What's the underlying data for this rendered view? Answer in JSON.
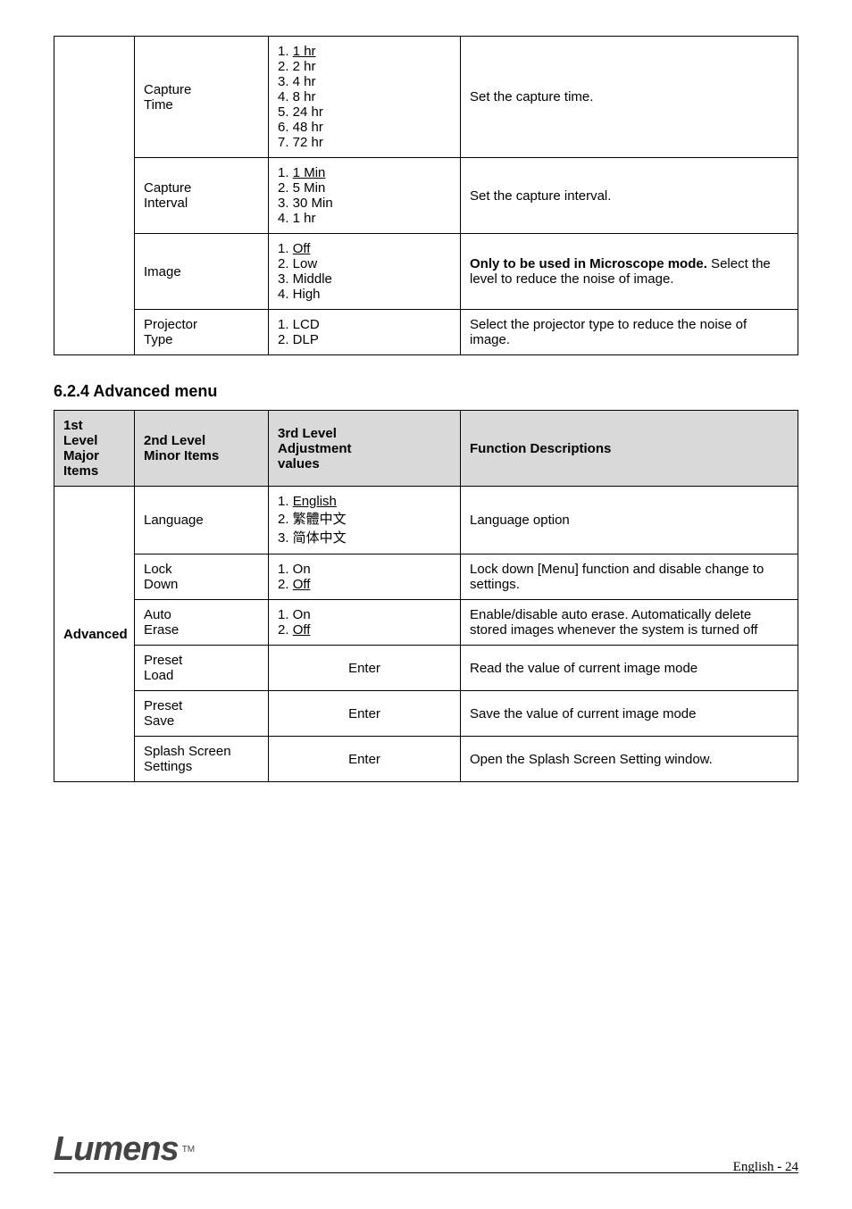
{
  "table1": {
    "col1_rowspan_label": "",
    "rows": [
      {
        "c2_line1": "Capture",
        "c2_line2": "Time",
        "c3_line1_prefix": "1.",
        "c3_line1_u": "1 hr",
        "c3_line2": "2. 2 hr",
        "c3_line3": "3. 4 hr",
        "c3_line4": "4. 8 hr",
        "c3_line5": "5. 24 hr",
        "c3_line6": "6. 48 hr",
        "c3_line7": "7. 72 hr",
        "c4": "Set the capture time."
      },
      {
        "c2_line1": "Capture",
        "c2_line2": "Interval",
        "c3_line1_prefix": "1.",
        "c3_line1_u": "1 Min",
        "c3_line2": "2. 5 Min",
        "c3_line3": "3. 30 Min",
        "c3_line4": "4. 1 hr",
        "c4": "Set the capture interval."
      },
      {
        "c2": "Image",
        "c3_line1_prefix": "1.",
        "c3_line1_u": "Off",
        "c3_line2": "2. Low",
        "c3_line3": "3. Middle",
        "c3_line4": "4. High",
        "c4_b": "Only to be used in Microscope mode.",
        "c4_rest": " Select the level to reduce the noise of image."
      },
      {
        "c2_line1": "Projector",
        "c2_line2": "Type",
        "c3_line1": "1. LCD",
        "c3_line2": "2. DLP",
        "c4": "Select the projector type to reduce the noise of image."
      }
    ]
  },
  "section_title": "6.2.4 Advanced menu",
  "table2": {
    "headers": {
      "h1_line1": "1st",
      "h1_line2": "Level",
      "h1_line3": "Major",
      "h1_line4": "Items",
      "h2_line1": "2nd Level",
      "h2_line2": "Minor Items",
      "h3_line1": "3rd Level",
      "h3_line2": "Adjustment",
      "h3_line3": "values",
      "h4": "Function Descriptions"
    },
    "group_label": "Advanced",
    "rows": [
      {
        "c2": "Language",
        "c3_prefix": "1.",
        "c3_u": "English",
        "c3_line2": "2. 繁體中文",
        "c3_line3": "3. 简体中文",
        "c4": "Language option"
      },
      {
        "c2_line1": "Lock",
        "c2_line2": "Down",
        "c3_line1_prefix": "1. On",
        "c3_line2_prefix": "2.",
        "c3_line2_u": "Off",
        "c4": "Lock down [Menu] function and disable change to settings."
      },
      {
        "c2_line1": "Auto",
        "c2_line2": "Erase",
        "c3_line1": "1. On",
        "c3_line2_prefix": "2.",
        "c3_line2_u": "Off",
        "c4": "Enable/disable auto erase. Automatically delete stored images whenever the system is turned off"
      },
      {
        "c2_line1": "Preset",
        "c2_line2": "Load",
        "c3": "Enter",
        "c4": "Read the value of current image mode"
      },
      {
        "c2_line1": "Preset",
        "c2_line2": "Save",
        "c3": "Enter",
        "c4": "Save the value of current image mode"
      },
      {
        "c2": "Splash Screen Settings",
        "c3": "Enter",
        "c4": "Open the Splash Screen Setting window."
      }
    ]
  },
  "footer": {
    "logo": "Lumens",
    "tm": "TM",
    "page_num_label_a": "English ",
    "page_num_label_b": "-",
    "page_num": " 24"
  }
}
